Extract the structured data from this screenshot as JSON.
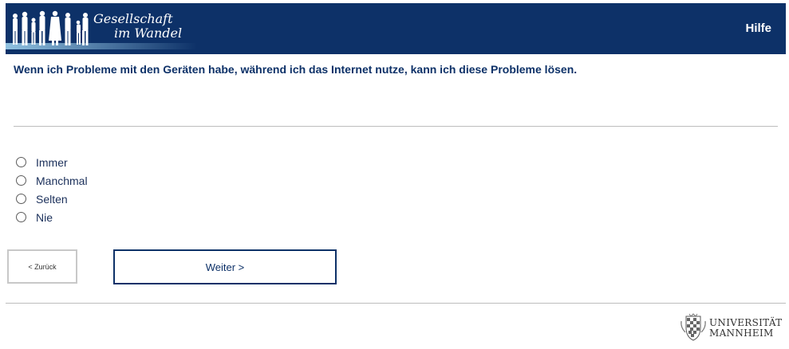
{
  "header": {
    "logo_line1": "Gesellschaft",
    "logo_line2": "im Wandel",
    "help_label": "Hilfe"
  },
  "question": {
    "text": "Wenn ich Probleme mit den Geräten habe, während ich das Internet nutze, kann ich diese Probleme lösen."
  },
  "options": [
    {
      "label": "Immer"
    },
    {
      "label": "Manchmal"
    },
    {
      "label": "Selten"
    },
    {
      "label": "Nie"
    }
  ],
  "navigation": {
    "back_label": "< Zurück",
    "next_label": "Weiter >"
  },
  "footer": {
    "university_line1": "UNIVERSITÄT",
    "university_line2": "MANNHEIM"
  },
  "colors": {
    "brand_navy": "#0d3168",
    "divider": "#bdbdbd"
  }
}
